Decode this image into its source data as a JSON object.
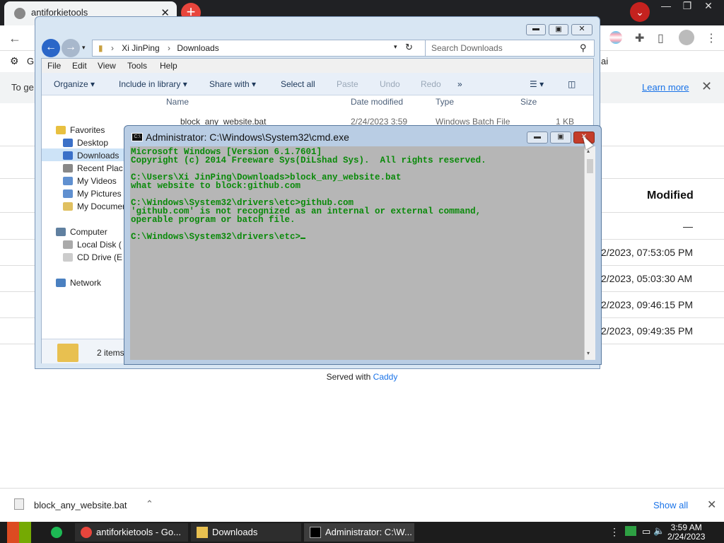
{
  "browser": {
    "tab_title": "antiforkietools",
    "infobar_text": "To ge",
    "infobar_link": "Learn more",
    "bookmark_partial": "G",
    "bookmark_partial_right": "ai"
  },
  "page": {
    "modified_header": "Modified",
    "rows": [
      {
        "modified": "—"
      },
      {
        "modified": "2/2023, 07:53:05 PM"
      },
      {
        "modified": "2/2023, 05:03:30 AM"
      },
      {
        "modified": "2/2023, 09:46:15 PM"
      },
      {
        "modified": "2/2023, 09:49:35 PM"
      }
    ],
    "served_prefix": "Served with",
    "served_link": "Caddy"
  },
  "downloads_bar": {
    "file": "block_any_website.bat",
    "show_all": "Show all"
  },
  "explorer": {
    "breadcrumb": [
      "Xi JinPing",
      "Downloads"
    ],
    "search_placeholder": "Search Downloads",
    "menu": [
      "File",
      "Edit",
      "View",
      "Tools",
      "Help"
    ],
    "commands": {
      "organize": "Organize",
      "include": "Include in library",
      "share": "Share with",
      "select_all": "Select all",
      "paste": "Paste",
      "undo": "Undo",
      "redo": "Redo",
      "more": "»"
    },
    "nav": {
      "favorites": "Favorites",
      "desktop": "Desktop",
      "downloads": "Downloads",
      "recent": "Recent Plac",
      "videos": "My Videos",
      "pictures": "My Pictures",
      "documents": "My Documer",
      "computer": "Computer",
      "local_disk": "Local Disk (",
      "cd_drive": "CD Drive (E",
      "network": "Network"
    },
    "columns": [
      "Name",
      "Date modified",
      "Type",
      "Size"
    ],
    "file_row": {
      "name": "block_any_website.bat",
      "date": "2/24/2023 3:59",
      "type": "Windows Batch File",
      "size": "1 KB"
    },
    "status": "2 items"
  },
  "cmd": {
    "title": "Administrator: C:\\Windows\\System32\\cmd.exe",
    "lines": [
      "Microsoft Windows [Version 6.1.7601]",
      "Copyright (c) 2014 Freeware Sys(DiLshad Sys).  All rights reserved.",
      "",
      "C:\\Users\\Xi JinPing\\Downloads>block_any_website.bat",
      "what website to block:github.com",
      "",
      "C:\\Windows\\System32\\drivers\\etc>github.com",
      "'github.com' is not recognized as an internal or external command,",
      "operable program or batch file.",
      "",
      "C:\\Windows\\System32\\drivers\\etc>"
    ]
  },
  "taskbar": {
    "items": [
      "antiforkietools - Go...",
      "Downloads",
      "Administrator: C:\\W..."
    ],
    "time": "3:59 AM",
    "date": "2/24/2023"
  }
}
